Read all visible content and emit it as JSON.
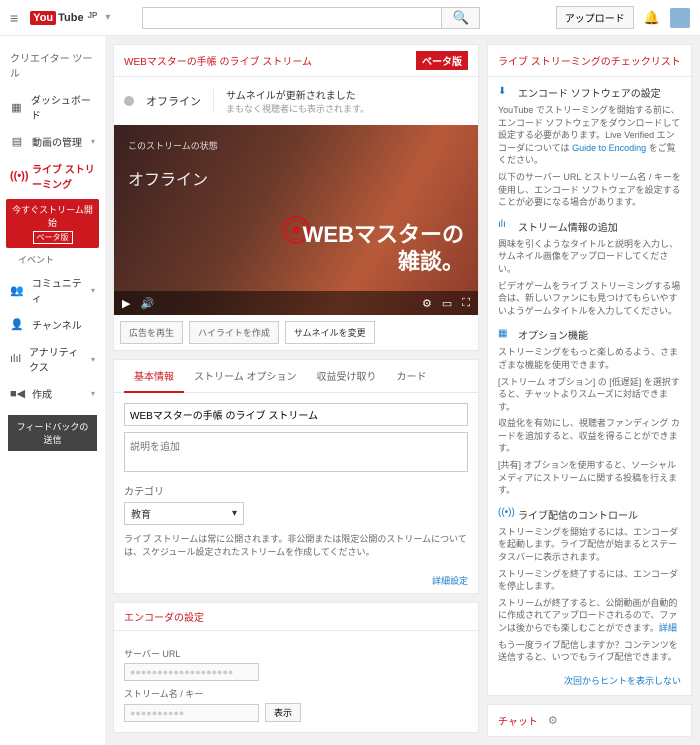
{
  "header": {
    "logo_box": "You",
    "logo_text": "Tube",
    "logo_jp": "JP",
    "search_placeholder": "",
    "upload": "アップロード"
  },
  "sidebar": {
    "title": "クリエイター ツール",
    "items": [
      {
        "icon": "▦",
        "label": "ダッシュボード"
      },
      {
        "icon": "▤",
        "label": "動画の管理",
        "chev": true
      },
      {
        "icon": "((•))",
        "label": "ライブ ストリーミング",
        "active": true
      },
      {
        "icon": "👥",
        "label": "コミュニティ",
        "chev": true
      },
      {
        "icon": "👤",
        "label": "チャンネル"
      },
      {
        "icon": "ılıl",
        "label": "アナリティクス",
        "chev": true
      },
      {
        "icon": "■◀",
        "label": "作成",
        "chev": true
      }
    ],
    "stream_now": "今すぐストリーム開始",
    "beta": "ベータ版",
    "event": "イベント",
    "feedback": "フィードバックの送信"
  },
  "stream": {
    "title": "WEBマスターの手帳 のライブ ストリーム",
    "beta": "ベータ版",
    "status": "オフライン",
    "msg": "サムネイルが更新されました",
    "sub": "まもなく視聴者にも表示されます。"
  },
  "player": {
    "top": "このストリームの状態",
    "offline": "オフライン",
    "title": "WEBマスターの\n雑談。"
  },
  "actions": {
    "replay": "広告を再生",
    "highlight": "ハイライトを作成",
    "thumbnail": "サムネイルを変更"
  },
  "tabs": [
    "基本情報",
    "ストリーム オプション",
    "収益受け取り",
    "カード"
  ],
  "form": {
    "title_value": "WEBマスターの手帳 のライブ ストリーム",
    "desc_placeholder": "説明を追加",
    "category_label": "カテゴリ",
    "category_value": "教育",
    "note": "ライブ ストリームは常に公開されます。非公開または限定公開のストリームについては、スケジュール設定されたストリームを作成してください。",
    "detail": "詳細設定"
  },
  "encoder": {
    "title": "エンコーダの設定",
    "url_label": "サーバー URL",
    "url_value": "●●●●●●●●●●●●●●●●●●●",
    "key_label": "ストリーム名 / キー",
    "key_value": "●●●●●●●●●●",
    "show": "表示"
  },
  "checklist": {
    "title": "ライブ ストリーミングのチェックリスト",
    "items": [
      {
        "head": "エンコード ソフトウェアの設定",
        "texts": [
          "YouTube でストリーミングを開始する前に、エンコード ソフトウェアをダウンロードして設定する必要があります。Live Verified エンコーダについては <a>Guide to Encoding</a> をご覧ください。",
          "以下のサーバー URL とストリーム名 / キーを使用し、エンコード ソフトウェアを設定することが必要になる場合があります。"
        ]
      },
      {
        "head": "ストリーム情報の追加",
        "texts": [
          "興味を引くようなタイトルと説明を入力し、サムネイル画像をアップロードしてください。",
          "ビデオゲームをライブ ストリーミングする場合は、新しいファンにも見つけてもらいやすいようゲームタイトルを入力してください。"
        ]
      },
      {
        "head": "オプション機能",
        "texts": [
          "ストリーミングをもっと楽しめるよう、さまざまな機能を使用できます。",
          "[ストリーム オプション] の [低遅延] を選択すると、チャットよりスムーズに対話できます。",
          "収益化を有効にし、視聴者ファンディング カードを追加すると、収益を得ることができます。",
          "[共有] オプションを使用すると、ソーシャル メディアにストリームに関する投稿を行えます。"
        ]
      },
      {
        "head": "ライブ配信のコントロール",
        "texts": [
          "ストリーミングを開始するには、エンコーダを起動します。ライブ配信が始まるとステータスバーに表示されます。",
          "ストリーミングを終了するには、エンコーダを停止します。",
          "ストリームが終了すると、公開動画が自動的に作成されてアップロードされるので、ファンは後からでも楽しむことができます。<a>詳細</a>",
          "もう一度ライブ配信しますか？コンテンツを送信すると、いつでもライブ配信できます。"
        ]
      }
    ],
    "hint": "次回からヒントを表示しない"
  },
  "chat": {
    "title": "チャット"
  }
}
